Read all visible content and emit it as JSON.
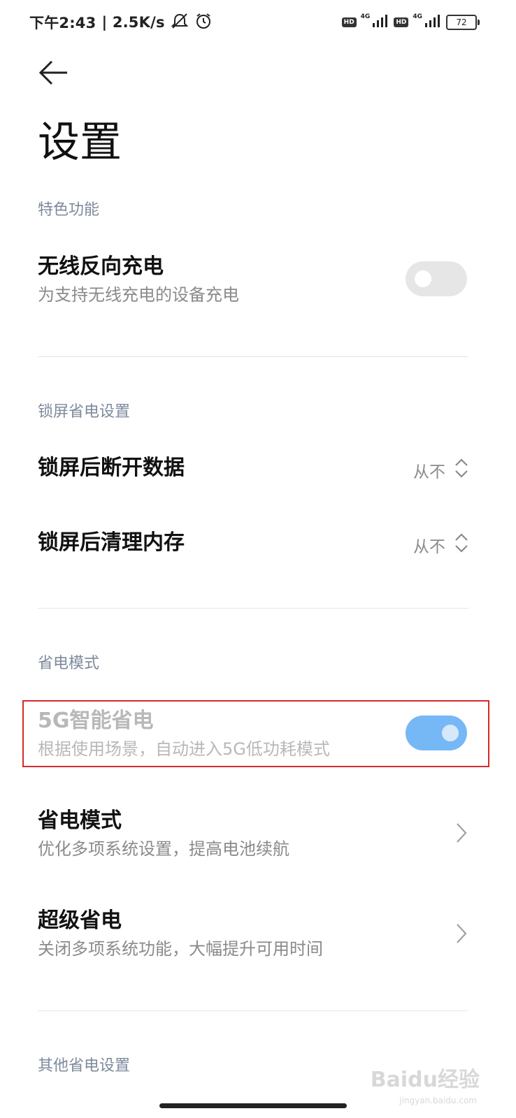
{
  "status_bar": {
    "time": "下午2:43",
    "speed": "| 2.5K/s",
    "hd1": "HD",
    "net1": "4G",
    "hd2": "HD",
    "net2": "4G",
    "battery": "72"
  },
  "page": {
    "title": "设置"
  },
  "sections": {
    "featured": {
      "header": "特色功能",
      "wireless_reverse": {
        "title": "无线反向充电",
        "subtitle": "为支持无线充电的设备充电",
        "enabled": false
      }
    },
    "lockscreen": {
      "header": "锁屏省电设置",
      "disconnect_data": {
        "title": "锁屏后断开数据",
        "value": "从不"
      },
      "clear_memory": {
        "title": "锁屏后清理内存",
        "value": "从不"
      }
    },
    "power_mode": {
      "header": "省电模式",
      "smart_5g": {
        "title": "5G智能省电",
        "subtitle": "根据使用场景，自动进入5G低功耗模式",
        "enabled": true
      },
      "power_saving": {
        "title": "省电模式",
        "subtitle": "优化多项系统设置，提高电池续航"
      },
      "ultra_saving": {
        "title": "超级省电",
        "subtitle": "关闭多项系统功能，大幅提升可用时间"
      }
    },
    "other": {
      "header": "其他省电设置"
    }
  },
  "watermark": {
    "logo": "Baidu经验",
    "url": "jingyan.baidu.com"
  },
  "colors": {
    "toggle_on": "#76b8f5",
    "toggle_off": "#e6e6e6",
    "highlight": "#d42a2a",
    "section_header": "#7d8a9c"
  }
}
